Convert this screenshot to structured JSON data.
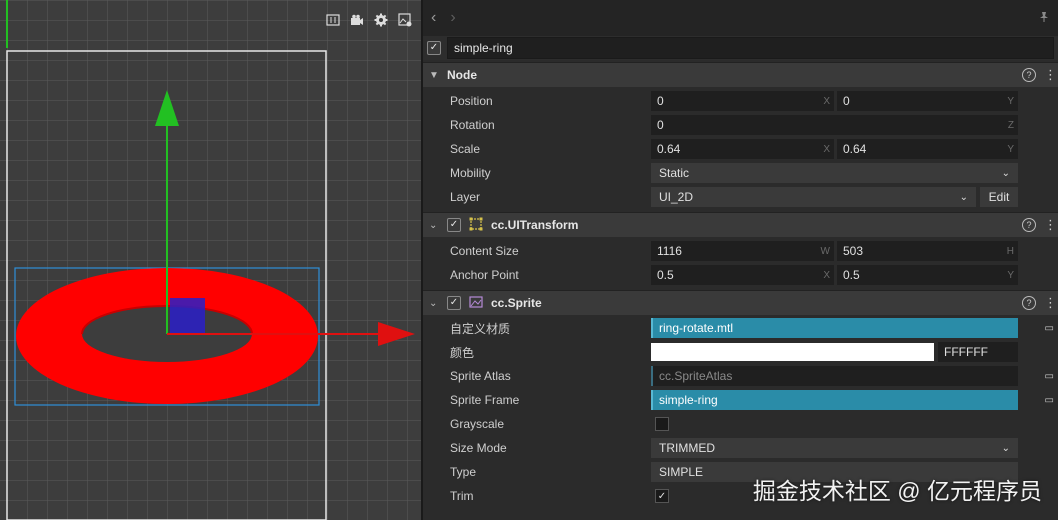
{
  "node": {
    "name": "simple-ring",
    "enabled": true
  },
  "scene_tools": [
    "frame-icon",
    "camera-icon",
    "gear-icon",
    "image-settings-icon"
  ],
  "sections": {
    "node": {
      "title": "Node",
      "position": {
        "label": "Position",
        "x": "0",
        "y": "0"
      },
      "rotation": {
        "label": "Rotation",
        "z": "0"
      },
      "scale": {
        "label": "Scale",
        "x": "0.64",
        "y": "0.64"
      },
      "mobility": {
        "label": "Mobility",
        "value": "Static"
      },
      "layer": {
        "label": "Layer",
        "value": "UI_2D",
        "edit": "Edit"
      }
    },
    "uitransform": {
      "title": "cc.UITransform",
      "content_size": {
        "label": "Content Size",
        "w": "1116",
        "h": "503"
      },
      "anchor_point": {
        "label": "Anchor Point",
        "x": "0.5",
        "y": "0.5"
      }
    },
    "sprite": {
      "title": "cc.Sprite",
      "material": {
        "label": "自定义材质",
        "value": "ring-rotate.mtl"
      },
      "color": {
        "label": "颜色",
        "hex": "FFFFFF",
        "swatch": "#ffffff"
      },
      "sprite_atlas": {
        "label": "Sprite Atlas",
        "value": "cc.SpriteAtlas"
      },
      "sprite_frame": {
        "label": "Sprite Frame",
        "value": "simple-ring"
      },
      "grayscale": {
        "label": "Grayscale",
        "checked": false
      },
      "size_mode": {
        "label": "Size Mode",
        "value": "TRIMMED"
      },
      "type": {
        "label": "Type",
        "value": "SIMPLE"
      },
      "trim": {
        "label": "Trim",
        "checked": true
      }
    }
  },
  "axis_labels": {
    "x": "X",
    "y": "Y",
    "z": "Z",
    "w": "W",
    "h": "H"
  },
  "watermark": "掘金技术社区 @ 亿元程序员",
  "colors": {
    "ring": "#ff0000",
    "gizmo_y": "#22c022",
    "gizmo_x": "#e01010",
    "selection": "#2a8ca8",
    "panel_bg": "#2b2b2b"
  }
}
